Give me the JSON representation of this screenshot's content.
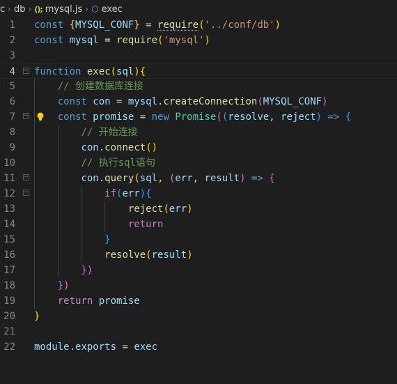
{
  "breadcrumb": {
    "items": [
      "c",
      "db"
    ],
    "file_icon": "();",
    "file": "mysql.js",
    "symbol": "exec"
  },
  "editor": {
    "current_line": 4,
    "lines": [
      {
        "n": "1",
        "segs": [
          [
            "const ",
            "k"
          ],
          [
            "{",
            "y"
          ],
          [
            "MYSQL_CONF",
            "v"
          ],
          [
            "}",
            "y"
          ],
          [
            " = ",
            "p"
          ],
          [
            "require",
            "req"
          ],
          [
            "(",
            "y"
          ],
          [
            "'../conf/db'",
            "s"
          ],
          [
            ")",
            "y"
          ]
        ]
      },
      {
        "n": "2",
        "segs": [
          [
            "const ",
            "k"
          ],
          [
            "mysql",
            "v"
          ],
          [
            " = ",
            "p"
          ],
          [
            "require",
            "f"
          ],
          [
            "(",
            "y"
          ],
          [
            "'mysql'",
            "s"
          ],
          [
            ")",
            "y"
          ]
        ]
      },
      {
        "n": "3",
        "segs": []
      },
      {
        "n": "4",
        "fold": true,
        "segs": [
          [
            "function ",
            "k"
          ],
          [
            "exec",
            "f"
          ],
          [
            "(",
            "y"
          ],
          [
            "sql",
            "v"
          ],
          [
            "){",
            "y"
          ]
        ]
      },
      {
        "n": "5",
        "segs": [
          [
            "    ",
            "p"
          ],
          [
            "// 创建数据库连接",
            "c"
          ]
        ]
      },
      {
        "n": "6",
        "segs": [
          [
            "    ",
            "p"
          ],
          [
            "const ",
            "k"
          ],
          [
            "con",
            "v"
          ],
          [
            " = ",
            "p"
          ],
          [
            "mysql",
            "v"
          ],
          [
            ".",
            "p"
          ],
          [
            "createConnection",
            "f"
          ],
          [
            "(",
            "purp"
          ],
          [
            "MYSQL_CONF",
            "v"
          ],
          [
            ")",
            "purp"
          ]
        ]
      },
      {
        "n": "7",
        "fold": true,
        "segs": [
          [
            "    ",
            "p"
          ],
          [
            "const ",
            "k"
          ],
          [
            "promise",
            "v"
          ],
          [
            " = ",
            "p"
          ],
          [
            "new ",
            "k"
          ],
          [
            "Promise",
            "cls"
          ],
          [
            "(",
            "purp"
          ],
          [
            "(",
            "blu"
          ],
          [
            "resolve",
            "v"
          ],
          [
            ", ",
            "p"
          ],
          [
            "reject",
            "v"
          ],
          [
            ")",
            "blu"
          ],
          [
            " => ",
            "k"
          ],
          [
            "{",
            "blu"
          ]
        ]
      },
      {
        "n": "8",
        "bulb": true,
        "segs": [
          [
            "        ",
            "p"
          ],
          [
            "// 开始连接",
            "c"
          ]
        ]
      },
      {
        "n": "9",
        "segs": [
          [
            "        ",
            "p"
          ],
          [
            "con",
            "v"
          ],
          [
            ".",
            "p"
          ],
          [
            "connect",
            "f"
          ],
          [
            "()",
            "y"
          ]
        ]
      },
      {
        "n": "10",
        "segs": [
          [
            "        ",
            "p"
          ],
          [
            "// 执行sql语句",
            "c"
          ]
        ]
      },
      {
        "n": "11",
        "fold": true,
        "segs": [
          [
            "        ",
            "p"
          ],
          [
            "con",
            "v"
          ],
          [
            ".",
            "p"
          ],
          [
            "query",
            "f"
          ],
          [
            "(",
            "y"
          ],
          [
            "sql",
            "v"
          ],
          [
            ", ",
            "p"
          ],
          [
            "(",
            "purp"
          ],
          [
            "err",
            "v"
          ],
          [
            ", ",
            "p"
          ],
          [
            "result",
            "v"
          ],
          [
            ")",
            "purp"
          ],
          [
            " => ",
            "k"
          ],
          [
            "{",
            "purp"
          ]
        ]
      },
      {
        "n": "12",
        "fold": true,
        "segs": [
          [
            "            ",
            "p"
          ],
          [
            "if",
            "ctl"
          ],
          [
            "(",
            "blu"
          ],
          [
            "err",
            "v"
          ],
          [
            ")",
            "blu"
          ],
          [
            "{",
            "blu"
          ]
        ]
      },
      {
        "n": "13",
        "segs": [
          [
            "                ",
            "p"
          ],
          [
            "reject",
            "f"
          ],
          [
            "(",
            "y"
          ],
          [
            "err",
            "v"
          ],
          [
            ")",
            "y"
          ]
        ]
      },
      {
        "n": "14",
        "segs": [
          [
            "                ",
            "p"
          ],
          [
            "return",
            "ctl"
          ]
        ]
      },
      {
        "n": "15",
        "segs": [
          [
            "            ",
            "p"
          ],
          [
            "}",
            "blu"
          ]
        ]
      },
      {
        "n": "16",
        "segs": [
          [
            "            ",
            "p"
          ],
          [
            "resolve",
            "f"
          ],
          [
            "(",
            "y"
          ],
          [
            "result",
            "v"
          ],
          [
            ")",
            "y"
          ]
        ]
      },
      {
        "n": "17",
        "segs": [
          [
            "        ",
            "p"
          ],
          [
            "})",
            "purp"
          ]
        ]
      },
      {
        "n": "18",
        "segs": [
          [
            "    ",
            "p"
          ],
          [
            "})",
            "purp"
          ]
        ]
      },
      {
        "n": "19",
        "segs": [
          [
            "    ",
            "p"
          ],
          [
            "return ",
            "ctl"
          ],
          [
            "promise",
            "v"
          ]
        ]
      },
      {
        "n": "20",
        "segs": [
          [
            "}",
            "y"
          ]
        ]
      },
      {
        "n": "21",
        "segs": []
      },
      {
        "n": "22",
        "segs": [
          [
            "module",
            "v"
          ],
          [
            ".",
            "p"
          ],
          [
            "exports",
            "v"
          ],
          [
            " = ",
            "p"
          ],
          [
            "exec",
            "v"
          ]
        ]
      }
    ]
  }
}
